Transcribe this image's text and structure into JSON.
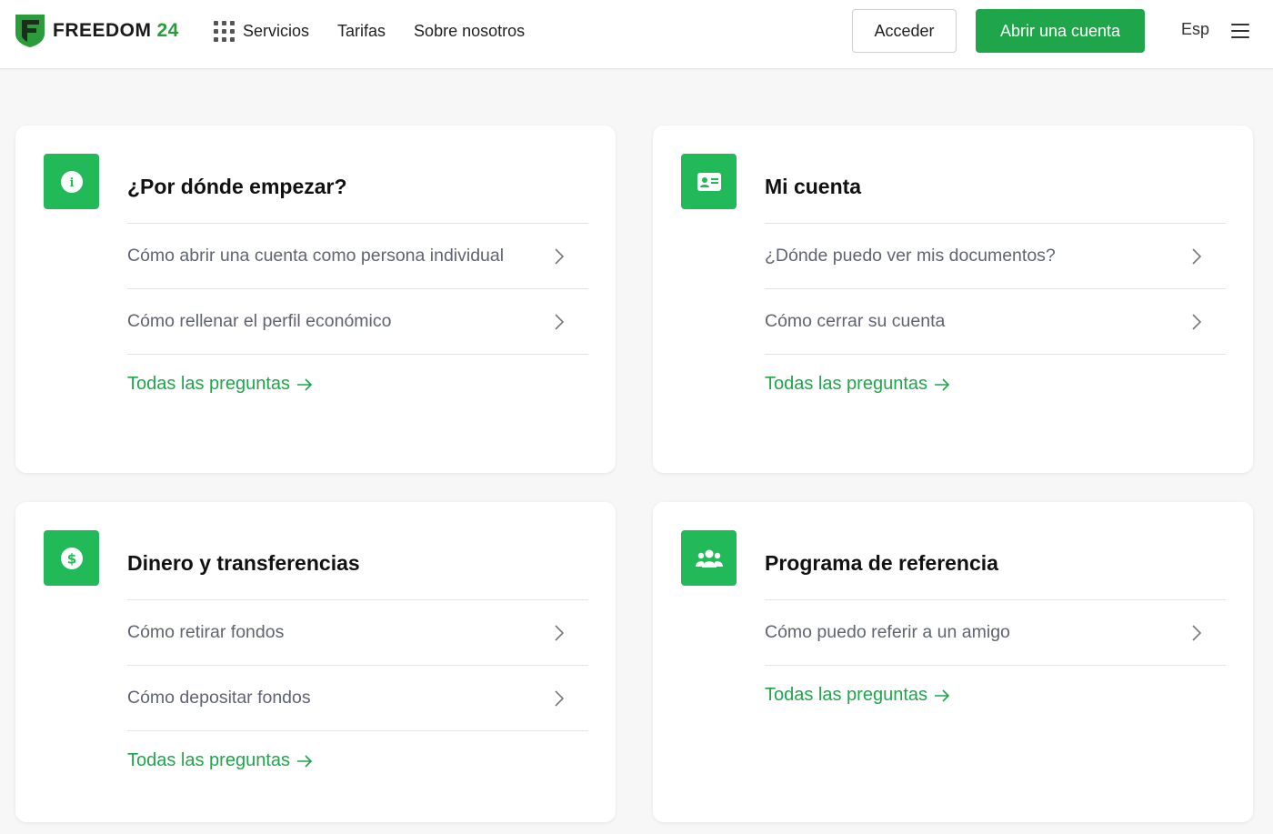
{
  "header": {
    "logo_word": "FREEDOM",
    "logo_num": "24",
    "nav": [
      {
        "label": "Servicios",
        "icon": "grid-icon"
      },
      {
        "label": "Tarifas"
      },
      {
        "label": "Sobre nosotros"
      }
    ],
    "login_label": "Acceder",
    "open_account_label": "Abrir una cuenta",
    "language": "Esp"
  },
  "colors": {
    "accent": "#1fa64a",
    "icon_bg": "#22b959",
    "logo_green": "#2b9c3a"
  },
  "cards": [
    {
      "icon": "info-icon",
      "title": "¿Por dónde empezar?",
      "items": [
        "Cómo abrir una cuenta como persona individual",
        "Cómo rellenar el perfil económico"
      ],
      "all_label": "Todas las preguntas"
    },
    {
      "icon": "id-card-icon",
      "title": "Mi cuenta",
      "items": [
        "¿Dónde puedo ver mis documentos?",
        "Cómo cerrar su cuenta"
      ],
      "all_label": "Todas las preguntas"
    },
    {
      "icon": "dollar-icon",
      "title": "Dinero y transferencias",
      "items": [
        "Cómo retirar fondos",
        "Cómo depositar fondos"
      ],
      "all_label": "Todas las preguntas"
    },
    {
      "icon": "group-icon",
      "title": "Programa de referencia",
      "items": [
        "Cómo puedo referir a un amigo"
      ],
      "all_label": "Todas las preguntas"
    }
  ]
}
